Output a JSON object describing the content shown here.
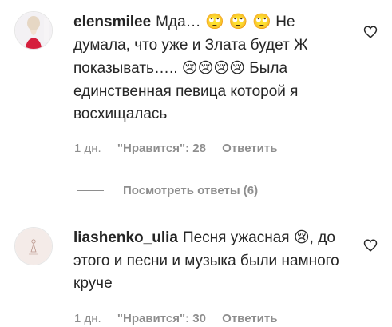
{
  "comments": [
    {
      "username": "elensmilee",
      "text_parts": [
        "Мда… ",
        "🙄 🙄 🙄",
        " Не думала, что уже и Злата будет Ж показывать….. ",
        "😢😢😢😢",
        " Была единственная певица которой я восхищалась"
      ],
      "time": "1 дн.",
      "likes": "\"Нравится\": 28",
      "reply": "Ответить"
    },
    {
      "username": "liashenko_ulia",
      "text_parts": [
        "Песня ужасная ",
        "😢",
        ", до этого и песни и музыка были намного круче"
      ],
      "time": "1 дн.",
      "likes": "\"Нравится\": 30",
      "reply": "Ответить"
    }
  ],
  "view_replies": "Посмотреть ответы (6)",
  "icons": {
    "like": "heart-outline-icon"
  }
}
